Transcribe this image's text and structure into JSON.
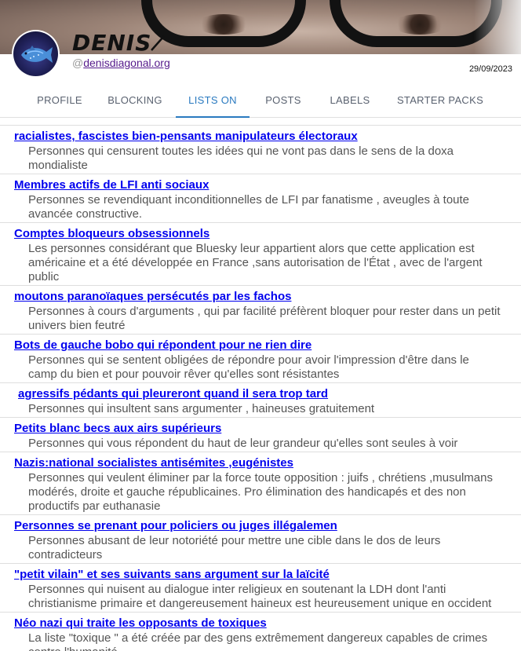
{
  "profile": {
    "display_name": "DENIS",
    "handle_prefix": "@",
    "handle": "denisdiagonal.org",
    "date": "29/09/2023"
  },
  "tabs": [
    {
      "label": "PROFILE"
    },
    {
      "label": "BLOCKING"
    },
    {
      "label": "LISTS ON"
    },
    {
      "label": "POSTS"
    },
    {
      "label": "LABELS"
    },
    {
      "label": "STARTER PACKS"
    }
  ],
  "active_tab": "LISTS ON",
  "colors": {
    "link": "#0000ee",
    "visited": "#551a8b",
    "active_tab": "#2a7ac0"
  },
  "lists": [
    {
      "title": "racialistes, fascistes bien-pensants manipulateurs électoraux",
      "desc": "Personnes qui censurent toutes les idées qui ne vont pas dans le sens de la doxa mondialiste"
    },
    {
      "title": "Membres actifs de LFI anti sociaux",
      "desc": "Personnes se revendiquant inconditionnelles de LFI par fanatisme , aveugles à toute avancée constructive."
    },
    {
      "title": "Comptes bloqueurs obsessionnels",
      "desc": "Les personnes considérant que Bluesky leur appartient alors que cette application est américaine et a été développée en France ,sans autorisation de l'État , avec de l'argent public"
    },
    {
      "title": "moutons paranoïaques persécutés par les fachos",
      "desc": "Personnes à cours d'arguments , qui par facilité préfèrent bloquer pour rester dans un petit univers bien feutré"
    },
    {
      "title": "Bots de gauche bobo qui répondent pour ne rien dire",
      "desc": "Personnes qui se sentent obligées de répondre pour avoir l'impression d'être dans le camp du bien et pour pouvoir rêver qu'elles sont résistantes"
    },
    {
      "title": " agressifs pédants qui pleureront quand il sera trop tard",
      "desc": "Personnes qui insultent sans argumenter , haineuses gratuitement"
    },
    {
      "title": "Petits blanc becs aux airs supérieurs",
      "desc": "Personnes qui vous répondent du haut de leur grandeur qu'elles sont seules à voir"
    },
    {
      "title": "Nazis:national socialistes antisémites ,eugénistes",
      "desc": "Personnes qui veulent éliminer par la force toute opposition : juifs , chrétiens ,musulmans modérés, droite et gauche républicaines. Pro élimination des handicapés et des non productifs par euthanasie"
    },
    {
      "title": "Personnes se prenant pour policiers ou juges illégalemen",
      "desc": "Personnes abusant de leur notoriété pour mettre une cible dans le dos de leurs contradicteurs"
    },
    {
      "title": "\"petit vilain\" et ses suivants sans argument sur la laïcité",
      "desc": "Personnes qui nuisent au dialogue inter religieux en soutenant la LDH dont l'anti christianisme primaire et dangereusement haineux est heureusement unique en occident"
    },
    {
      "title": "Néo nazi qui traite les opposants de toxiques",
      "desc": "La liste \"toxique \" a été créée par des gens extrêmement dangereux capables de crimes contre l'humanité"
    }
  ]
}
